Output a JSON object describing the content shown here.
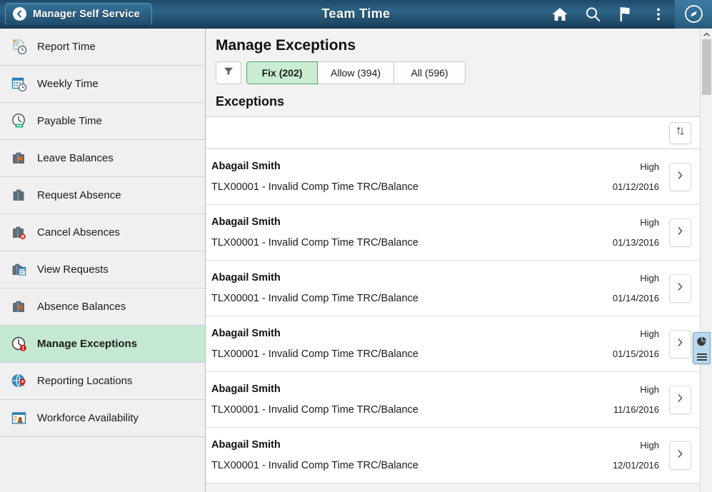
{
  "header": {
    "back_label": "Manager Self Service",
    "title": "Team Time",
    "icons": [
      {
        "name": "home-icon"
      },
      {
        "name": "search-icon"
      },
      {
        "name": "flag-icon"
      },
      {
        "name": "vertical-dots-icon"
      },
      {
        "name": "navbar-compass-icon"
      }
    ]
  },
  "sidebar": {
    "items": [
      {
        "label": "Report Time",
        "icon": "report-time-icon",
        "active": false
      },
      {
        "label": "Weekly Time",
        "icon": "weekly-time-icon",
        "active": false
      },
      {
        "label": "Payable Time",
        "icon": "payable-time-icon",
        "active": false
      },
      {
        "label": "Leave Balances",
        "icon": "leave-balances-icon",
        "active": false
      },
      {
        "label": "Request Absence",
        "icon": "request-absence-icon",
        "active": false
      },
      {
        "label": "Cancel Absences",
        "icon": "cancel-absences-icon",
        "active": false
      },
      {
        "label": "View Requests",
        "icon": "view-requests-icon",
        "active": false
      },
      {
        "label": "Absence Balances",
        "icon": "absence-balances-icon",
        "active": false
      },
      {
        "label": "Manage Exceptions",
        "icon": "manage-exceptions-icon",
        "active": true
      },
      {
        "label": "Reporting Locations",
        "icon": "reporting-locations-icon",
        "active": false
      },
      {
        "label": "Workforce Availability",
        "icon": "workforce-availability-icon",
        "active": false
      }
    ]
  },
  "main": {
    "page_title": "Manage Exceptions",
    "filter_icon": "funnel-filter-icon",
    "tabs": [
      {
        "label": "Fix (202)",
        "active": true
      },
      {
        "label": "Allow (394)",
        "active": false
      },
      {
        "label": "All (596)",
        "active": false
      }
    ],
    "section_title": "Exceptions",
    "sort_icon": "sort-arrows-icon",
    "rows": [
      {
        "name": "Abagail Smith",
        "description": "TLX00001 - Invalid Comp Time TRC/Balance",
        "severity": "High",
        "date": "01/12/2016"
      },
      {
        "name": "Abagail Smith",
        "description": "TLX00001 - Invalid Comp Time TRC/Balance",
        "severity": "High",
        "date": "01/13/2016"
      },
      {
        "name": "Abagail Smith",
        "description": "TLX00001 - Invalid Comp Time TRC/Balance",
        "severity": "High",
        "date": "01/14/2016"
      },
      {
        "name": "Abagail Smith",
        "description": "TLX00001 - Invalid Comp Time TRC/Balance",
        "severity": "High",
        "date": "01/15/2016"
      },
      {
        "name": "Abagail Smith",
        "description": "TLX00001 - Invalid Comp Time TRC/Balance",
        "severity": "High",
        "date": "11/16/2016"
      },
      {
        "name": "Abagail Smith",
        "description": "TLX00001 - Invalid Comp Time TRC/Balance",
        "severity": "High",
        "date": "12/01/2016"
      }
    ]
  },
  "right_rail": {
    "report_tab_icon": "pie-chart-report-icon",
    "scroll_up_icon": "chevron-up-icon"
  },
  "colors": {
    "header_blue": "#2c6488",
    "active_green": "#c9ecd3",
    "sidebar_active_green": "#c4e8d1",
    "report_tab_blue": "#b8d8ef"
  }
}
